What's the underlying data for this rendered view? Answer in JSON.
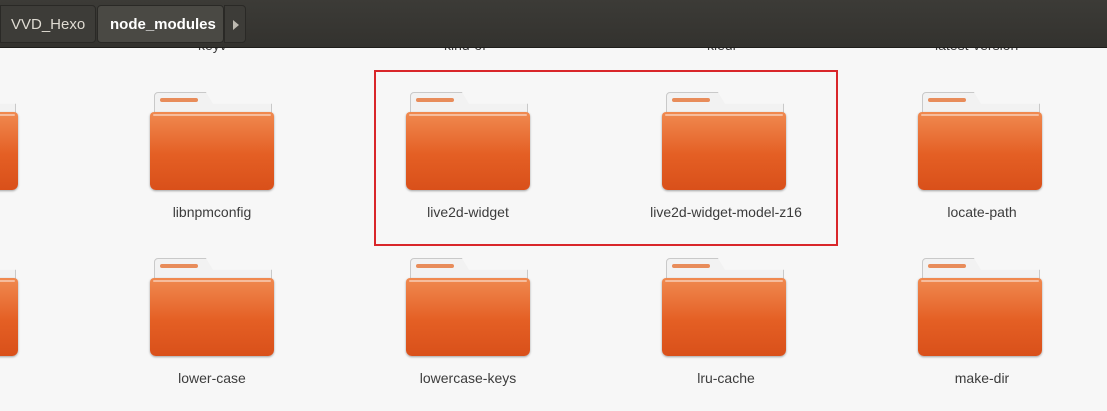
{
  "header": {
    "breadcrumbs": [
      {
        "label": "VVD_Hexo"
      },
      {
        "label": "node_modules"
      }
    ],
    "more_icon": "chevron-right-icon"
  },
  "partial_top_labels": [
    "keyv",
    "kind-of",
    "kleur",
    "latest-version"
  ],
  "rows": [
    [
      {
        "label": "libnpmconfig",
        "icon": "folder-icon"
      },
      {
        "label": "live2d-widget",
        "icon": "folder-icon"
      },
      {
        "label": "live2d-widget-model-z16",
        "icon": "folder-icon"
      },
      {
        "label": "locate-path",
        "icon": "folder-icon"
      }
    ],
    [
      {
        "label": "lower-case",
        "icon": "folder-icon"
      },
      {
        "label": "lowercase-keys",
        "icon": "folder-icon"
      },
      {
        "label": "lru-cache",
        "icon": "folder-icon"
      },
      {
        "label": "make-dir",
        "icon": "folder-icon"
      }
    ]
  ],
  "highlight_color": "#d9262a",
  "folder_color": "#e45f24"
}
